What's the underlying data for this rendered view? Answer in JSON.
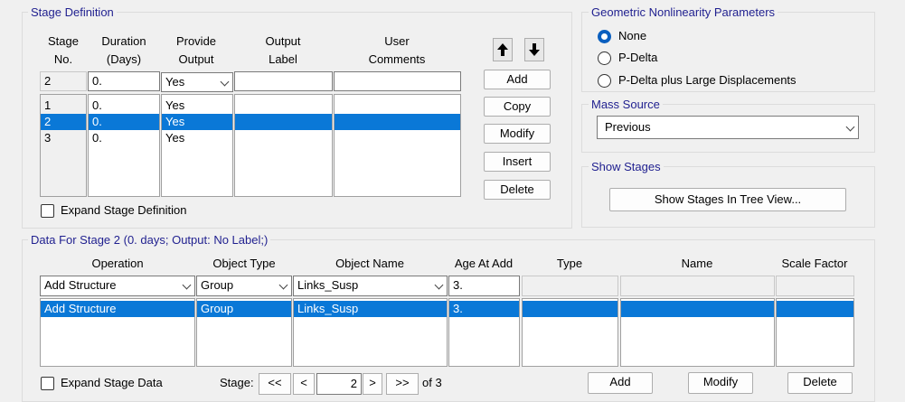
{
  "stage_definition": {
    "title": "Stage Definition",
    "headers": {
      "stage_no": "Stage\nNo.",
      "duration": "Duration\n(Days)",
      "provide_output": "Provide\nOutput",
      "output_label": "Output\nLabel",
      "user_comments": "User\nComments"
    },
    "edit_row": {
      "stage_no": "2",
      "duration": "0.",
      "provide_output": "Yes",
      "output_label": "",
      "user_comments": ""
    },
    "rows": [
      {
        "stage_no": "1",
        "duration": "0.",
        "provide_output": "Yes",
        "selected": false
      },
      {
        "stage_no": "2",
        "duration": "0.",
        "provide_output": "Yes",
        "selected": true
      },
      {
        "stage_no": "3",
        "duration": "0.",
        "provide_output": "Yes",
        "selected": false
      }
    ],
    "buttons": {
      "add": "Add",
      "copy": "Copy",
      "modify": "Modify",
      "insert": "Insert",
      "delete": "Delete"
    },
    "expand_label": "Expand Stage Definition",
    "expand_checked": false
  },
  "geometric_nonlinearity": {
    "title": "Geometric Nonlinearity Parameters",
    "options": [
      "None",
      "P-Delta",
      "P-Delta plus Large Displacements"
    ],
    "selected_index": 0
  },
  "mass_source": {
    "title": "Mass Source",
    "value": "Previous"
  },
  "show_stages": {
    "title": "Show Stages",
    "button_label": "Show Stages In Tree View..."
  },
  "stage_data": {
    "title": "Data For Stage 2  (0. days;  Output: No Label;)",
    "headers": {
      "operation": "Operation",
      "object_type": "Object Type",
      "object_name": "Object Name",
      "age_at_add": "Age At Add",
      "type": "Type",
      "name": "Name",
      "scale_factor": "Scale Factor"
    },
    "edit_row": {
      "operation": "Add Structure",
      "object_type": "Group",
      "object_name": "Links_Susp",
      "age_at_add": "3."
    },
    "rows": [
      {
        "operation": "Add Structure",
        "object_type": "Group",
        "object_name": "Links_Susp",
        "age_at_add": "3.",
        "type": "",
        "name": "",
        "scale_factor": "",
        "selected": true
      }
    ],
    "expand_label": "Expand Stage Data",
    "expand_checked": false,
    "nav": {
      "label": "Stage:",
      "first": "<<",
      "prev": "<",
      "current": "2",
      "next": ">",
      "last": ">>",
      "of_total": "of 3"
    },
    "buttons": {
      "add": "Add",
      "modify": "Modify",
      "delete": "Delete"
    }
  },
  "colors": {
    "selection": "#0a78d7",
    "group_title": "#1f1f8f",
    "radio_accent": "#0a5fbf"
  }
}
